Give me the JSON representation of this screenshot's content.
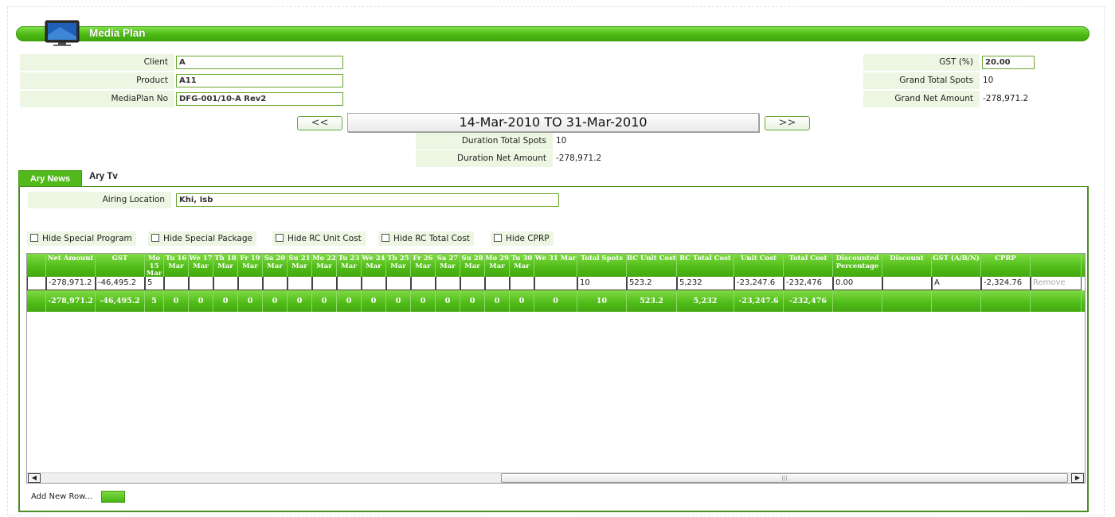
{
  "page": {
    "title": "Media Plan"
  },
  "header": {
    "client_label": "Client",
    "client_value": "A",
    "product_label": "Product",
    "product_value": "A11",
    "mediaplan_label": "MediaPlan No",
    "mediaplan_value": "DFG-001/10-A Rev2",
    "gst_label": "GST (%)",
    "gst_value": "20.00",
    "grand_total_spots_label": "Grand Total Spots",
    "grand_total_spots_value": "10",
    "grand_net_amount_label": "Grand Net Amount",
    "grand_net_amount_value": "-278,971.2"
  },
  "period": {
    "prev_label": "<<",
    "next_label": ">>",
    "range": "14-Mar-2010 TO 31-Mar-2010",
    "duration_spots_label": "Duration Total Spots",
    "duration_spots_value": "10",
    "duration_net_label": "Duration Net Amount",
    "duration_net_value": "-278,971.2"
  },
  "tabs": [
    {
      "label": "Ary News",
      "active": true
    },
    {
      "label": "Ary Tv",
      "active": false
    }
  ],
  "airing": {
    "label": "Airing Location",
    "value": "Khi, Isb"
  },
  "toggles": [
    {
      "label": "Hide Special Program",
      "checked": false
    },
    {
      "label": "Hide Special Package",
      "checked": false
    },
    {
      "label": "Hide RC Unit Cost",
      "checked": false
    },
    {
      "label": "Hide RC Total Cost",
      "checked": false
    },
    {
      "label": "Hide CPRP",
      "checked": false
    }
  ],
  "grid": {
    "columns": [
      "Net Amount",
      "GST",
      "Mo 15 Mar",
      "Tu 16 Mar",
      "We 17 Mar",
      "Th 18 Mar",
      "Fr 19 Mar",
      "Sa 20 Mar",
      "Su 21 Mar",
      "Mo 22 Mar",
      "Tu 23 Mar",
      "We 24 Mar",
      "Th 25 Mar",
      "Fr 26 Mar",
      "Sa 27 Mar",
      "Su 28 Mar",
      "Mo 29 Mar",
      "Tu 30 Mar",
      "We 31 Mar",
      "Total Spots",
      "RC Unit Cost",
      "RC Total Cost",
      "Unit Cost",
      "Total Cost",
      "Discounted Percentage",
      "Discount",
      "GST (A/B/N)",
      "CPRP",
      ""
    ],
    "row": [
      "-278,971.2",
      "-46,495.2",
      "5",
      "",
      "",
      "",
      "",
      "",
      "",
      "",
      "",
      "",
      "",
      "",
      "",
      "",
      "",
      "",
      "",
      "10",
      "523.2",
      "5,232",
      "-23,247.6",
      "-232,476",
      "0.00",
      "",
      "A",
      "-2,324.76",
      "Remove"
    ],
    "totals": [
      "-278,971.2",
      "-46,495.2",
      "5",
      "0",
      "0",
      "0",
      "0",
      "0",
      "0",
      "0",
      "0",
      "0",
      "0",
      "0",
      "0",
      "0",
      "0",
      "0",
      "0",
      "10",
      "523.2",
      "5,232",
      "-23,247.6",
      "-232,476",
      "",
      "",
      "",
      "",
      ""
    ]
  },
  "footer": {
    "add_row_label": "Add New Row..."
  },
  "colors": {
    "accent": "#4fbb17",
    "accent_dark": "#3b9a0d",
    "label_bg": "#edf6e2"
  },
  "icons": {
    "title_icon": "monitor-icon"
  }
}
